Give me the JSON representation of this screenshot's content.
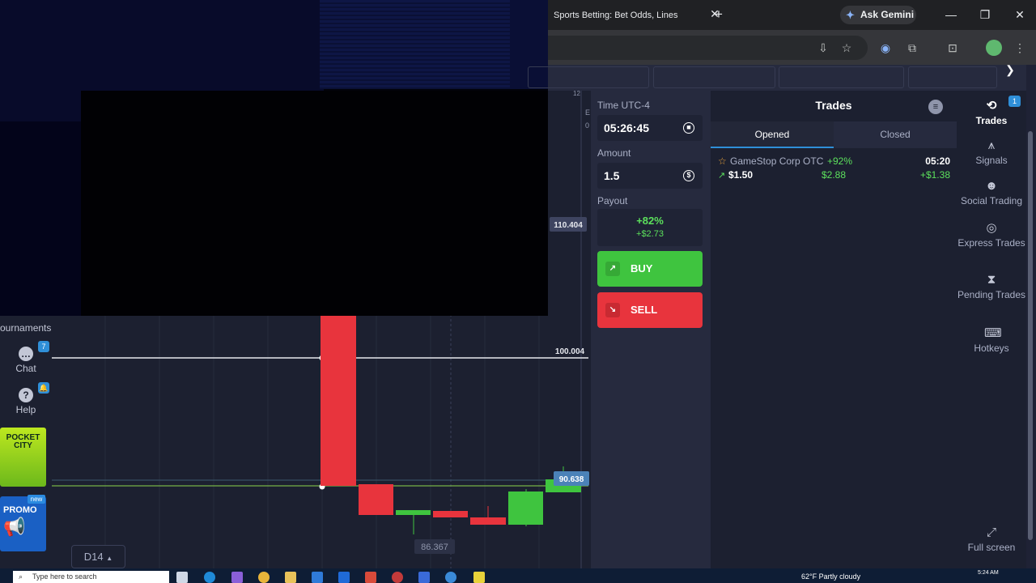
{
  "browser": {
    "tab_title": "Sports Betting: Bet Odds, Lines",
    "tab_close": "✕",
    "new_tab": "+",
    "gemini_label": "Ask Gemini",
    "minimize": "—",
    "maximize": "❐",
    "close": "✕"
  },
  "chart": {
    "price_high": "110.404",
    "price_mid": "100.004",
    "price_current": "90.638",
    "price_low": "86.367",
    "axis_top": "12",
    "axis_e": "E",
    "axis_zero": "0",
    "timeframe": "D14"
  },
  "left_sidebar": {
    "tournaments_label": "ournaments",
    "chat_label": "Chat",
    "chat_badge": "7",
    "help_label": "Help",
    "help_badge": "🔔",
    "pocket_city": "POCKET CITY",
    "promo_label": "PROMO",
    "new_badge": "new"
  },
  "controls": {
    "time_label": "Time UTC-4",
    "time_value": "05:26:45",
    "amount_label": "Amount",
    "amount_value": "1.5",
    "payout_label": "Payout",
    "payout_pct": "+82%",
    "payout_amount": "+$2.73",
    "buy_label": "BUY",
    "sell_label": "SELL"
  },
  "trades": {
    "title": "Trades",
    "tab_opened": "Opened",
    "tab_closed": "Closed",
    "items": [
      {
        "asset": "GameStop Corp OTC",
        "pct": "+92%",
        "time": "05:20",
        "amount": "$1.50",
        "payout": "$2.88",
        "profit": "+$1.38"
      }
    ]
  },
  "right_nav": {
    "trades_label": "Trades",
    "trades_badge": "1",
    "signals_label": "Signals",
    "social_label": "Social Trading",
    "express_label": "Express Trades",
    "pending_label": "Pending Trades",
    "hotkeys_label": "Hotkeys",
    "fullscreen_label": "Full screen"
  },
  "taskbar": {
    "search_placeholder": "Type here to search",
    "weather": "62°F  Partly cloudy",
    "time": "5:24 AM"
  },
  "colors": {
    "up": "#3fc43f",
    "down": "#e8343d",
    "accent": "#2f8fd8",
    "panel": "#262a3e"
  }
}
